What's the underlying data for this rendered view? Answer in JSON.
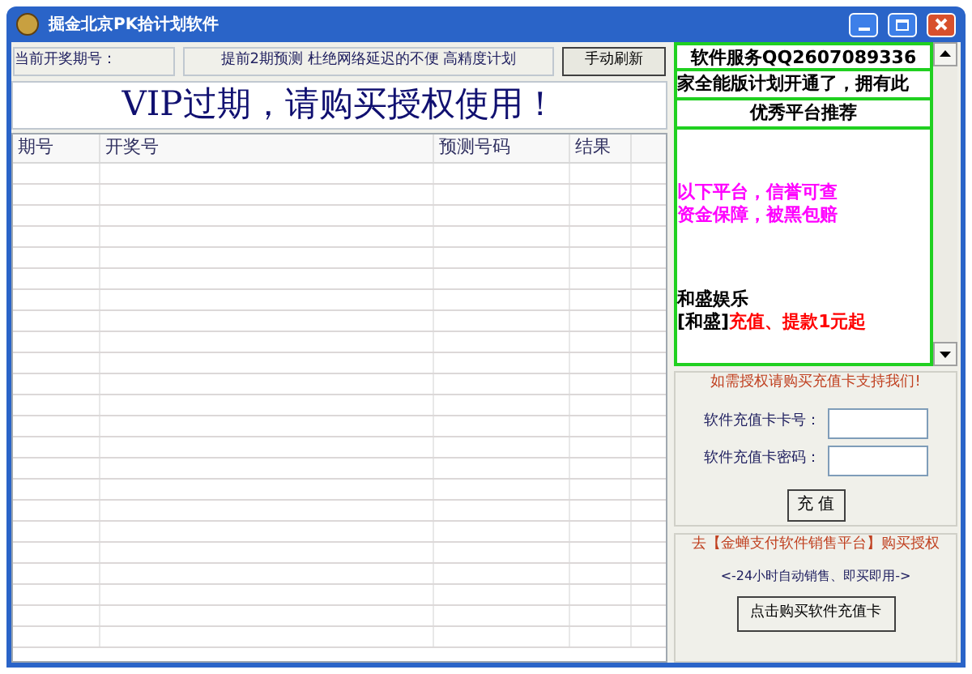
{
  "window": {
    "title": "掘金北京PK拾计划软件"
  },
  "toolbar": {
    "period_label": "当前开奖期号：",
    "notice": "提前2期预测 杜绝网络延迟的不便 高精度计划",
    "refresh_button": "手动刷新"
  },
  "banner": "VIP过期，请购买授权使用！",
  "table": {
    "columns": [
      "期号",
      "开奖号",
      "预测号码",
      "结果"
    ]
  },
  "ad_panel": {
    "service": "软件服务QQ2607089336",
    "marquee": "家全能版计划开通了，拥有此",
    "heading": "优秀平台推荐",
    "lines": [
      {
        "text": "以下平台，信誉可查",
        "color": "#ff00ff"
      },
      {
        "text": "资金保障，被黑包赔",
        "color": "#ff00ff"
      }
    ],
    "platform": "和盛娱乐",
    "promo_tag": "[和盛]",
    "promo_text": "充值、提款1元起"
  },
  "recharge": {
    "legend": "如需授权请购买充值卡支持我们!",
    "card_label": "软件充值卡卡号：",
    "password_label": "软件充值卡密码：",
    "button": "充 值"
  },
  "purchase": {
    "legend": "去【金蝉支付软件销售平台】购买授权",
    "note": "<-24小时自动销售、即买即用->",
    "button": "点击购买软件充值卡"
  }
}
